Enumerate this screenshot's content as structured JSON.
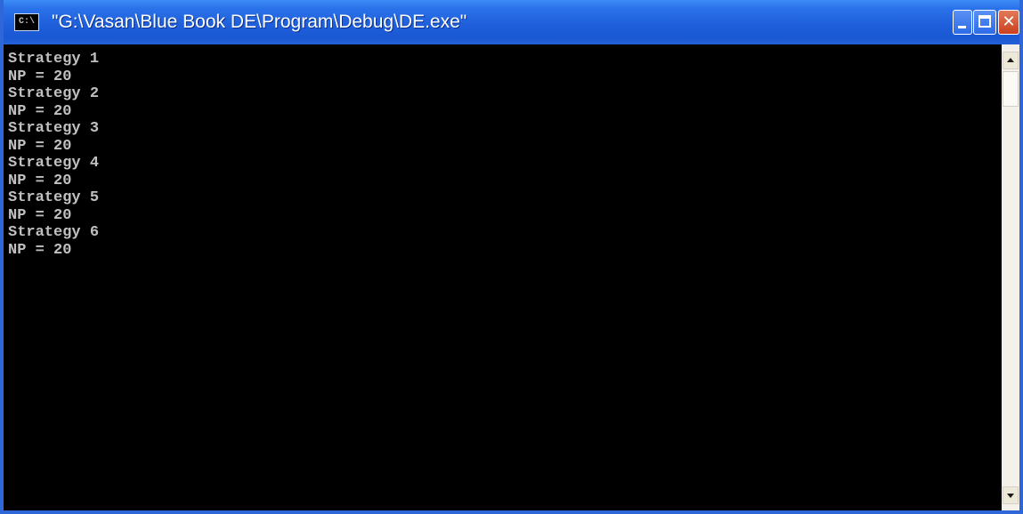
{
  "window": {
    "title": "\"G:\\Vasan\\Blue Book DE\\Program\\Debug\\DE.exe\"",
    "icon": "console-icon",
    "icon_text": "C:\\",
    "close_symbol": "✕"
  },
  "console": {
    "lines": [
      "Strategy 1",
      "NP = 20",
      "Strategy 2",
      "NP = 20",
      "Strategy 3",
      "NP = 20",
      "Strategy 4",
      "NP = 20",
      "Strategy 5",
      "NP = 20",
      "Strategy 6",
      "NP = 20"
    ]
  },
  "colors": {
    "titlebar": "#1f5fdb",
    "console_bg": "#000000",
    "console_text": "#c0c0c0"
  }
}
